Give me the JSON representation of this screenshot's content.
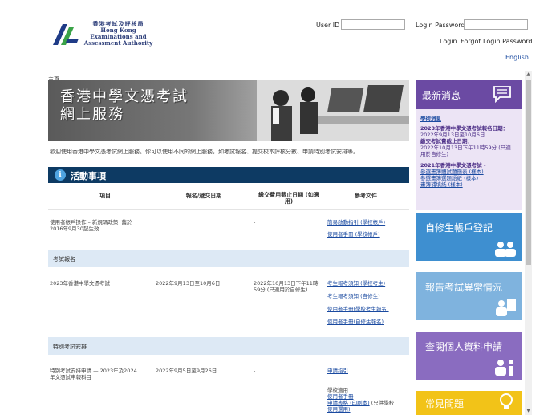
{
  "header": {
    "org_name_zh": "香港考試及評核局",
    "org_name_en_1": "Hong Kong",
    "org_name_en_2": "Examinations and",
    "org_name_en_3": "Assessment Authority",
    "user_id_label": "User ID",
    "user_id_value": "",
    "password_label": "Login Password",
    "password_value": "",
    "login_link": "Login",
    "forgot_link": "Forgot Login Password",
    "language_link": "English"
  },
  "breadcrumb": "主頁",
  "hero": {
    "title_line1": "香港中學文憑考試",
    "title_line2": "網上服務"
  },
  "intro": "歡迎使用香港中學文憑考試網上服務。你可以使用不同的網上服務，如考試報名、提交校本評核分數、申請特別考試安排等。",
  "activities": {
    "title": "活動事項",
    "headers": [
      "項目",
      "報名/遞交日期",
      "繳交費用截止日期 (如適用)",
      "參考文件"
    ],
    "row1": {
      "item_line1": "使用者帳戶操作 – 新規碼政策  舊於",
      "item_line2": "2016年9月30起生效",
      "deadline": "-",
      "doc1": "簡易啟動指引 (學校帳戶)",
      "doc2": "使用者手冊 (學校帳戶)"
    },
    "group1": "考試報名",
    "row2": {
      "item": "2023年香港中學文憑考試",
      "period": "2022年9月13日至10月6日",
      "deadline_line1": "2022年10月13日下午11時",
      "deadline_line2": "59分 (只適用於自修生)",
      "doc1": "考生報考須知 (學校考生)",
      "doc2": "考生報考須知 (自修生)",
      "doc3": "使用者手冊(學校考生報名)",
      "doc4": "使用者手冊(自修生報名)"
    },
    "group2": "特別考試安排",
    "row3": {
      "item_line1": "特別考試安排申請 — 2023年及2024",
      "item_line2": "年文憑試申報科目",
      "period": "2022年9月5日至9月26日",
      "deadline": "-",
      "doc1": "申請指引",
      "doc2": "學校適用",
      "doc3": "使用者手冊",
      "doc4": "申請表格 (印刷本)",
      "doc4_note": "(只供學校",
      "doc5": "使用選用)"
    }
  },
  "news": {
    "title": "最新消息",
    "l1": "學術消息",
    "l2": "2023年香港中學文憑考試報名日期：",
    "l3": "2022年9月13日至10月6日",
    "l4": "繳交考試費截止日期：",
    "l5": "2022年10月13日下午11時59分 (只適",
    "l6": "用於自修生)",
    "l7": "2021年香港中學文憑考試 -",
    "l8": "參選畫簿體試題簡表 (樣本)",
    "l9": "參選畫簿選題語紙 (樣本)",
    "l10": "畫簿補填紙 (樣本)"
  },
  "tiles": {
    "self_account": "自修生帳戶登記",
    "report_irregularity": "報告考試異常情況",
    "data_access": "查閱個人資料申請",
    "faq": "常見問題"
  },
  "colors": {
    "navy": "#0d3a63",
    "purple": "#6b4aa3",
    "blue_tile": "#3e8fd0",
    "light_blue_tile": "#7fb3de",
    "violet_tile": "#8a6cc0",
    "faq_tile": "#f2c318"
  }
}
